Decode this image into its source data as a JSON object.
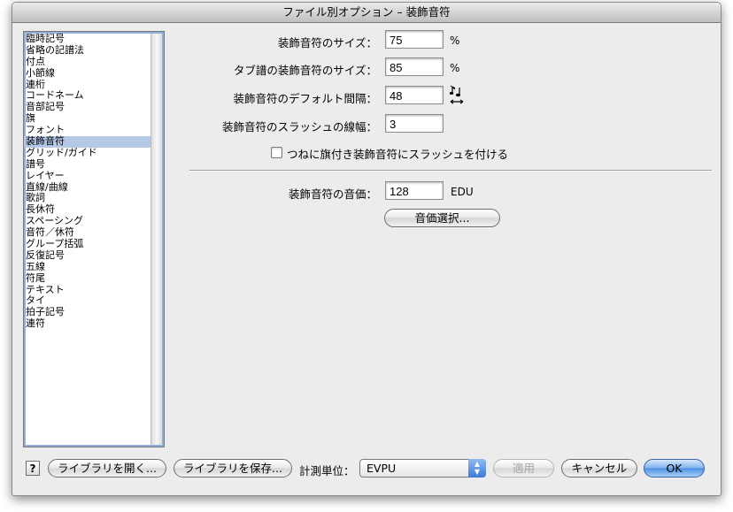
{
  "window": {
    "title": "ファイル別オプション – 装飾音符"
  },
  "sidebar": {
    "selected_index": 9,
    "items": [
      "臨時記号",
      "省略の記譜法",
      "付点",
      "小節線",
      "連桁",
      "コードネーム",
      "音部記号",
      "旗",
      "フォント",
      "装飾音符",
      "グリッド/ガイド",
      "譜号",
      "レイヤー",
      "直線/曲線",
      "歌詞",
      "長休符",
      "スペーシング",
      "音符／休符",
      "グループ括弧",
      "反復記号",
      "五線",
      "符尾",
      "テキスト",
      "タイ",
      "拍子記号",
      "連符"
    ]
  },
  "form": {
    "size": {
      "label": "装飾音符のサイズ：",
      "value": "75",
      "unit": "%"
    },
    "tab_size": {
      "label": "タブ譜の装飾音符のサイズ：",
      "value": "85",
      "unit": "%"
    },
    "spacing": {
      "label": "装飾音符のデフォルト間隔：",
      "value": "48"
    },
    "slash_width": {
      "label": "装飾音符のスラッシュの線幅：",
      "value": "3"
    },
    "always_slash": {
      "label": "つねに旗付き装飾音符にスラッシュを付ける",
      "checked": false
    },
    "duration": {
      "label": "装飾音符の音価：",
      "value": "128",
      "unit": "EDU"
    },
    "select_duration_button": "音価選択..."
  },
  "footer": {
    "help": "?",
    "open_library": "ライブラリを開く...",
    "save_library": "ライブラリを保存...",
    "units_label": "計測単位：",
    "units_value": "EVPU",
    "apply": "適用",
    "cancel": "キャンセル",
    "ok": "OK"
  },
  "icons": {
    "spacing": "grace-note-spacing-icon",
    "units_arrows": "updown-arrows-icon"
  },
  "colors": {
    "selection": "#b5c8e6",
    "default_button": "#4b8fe3"
  }
}
